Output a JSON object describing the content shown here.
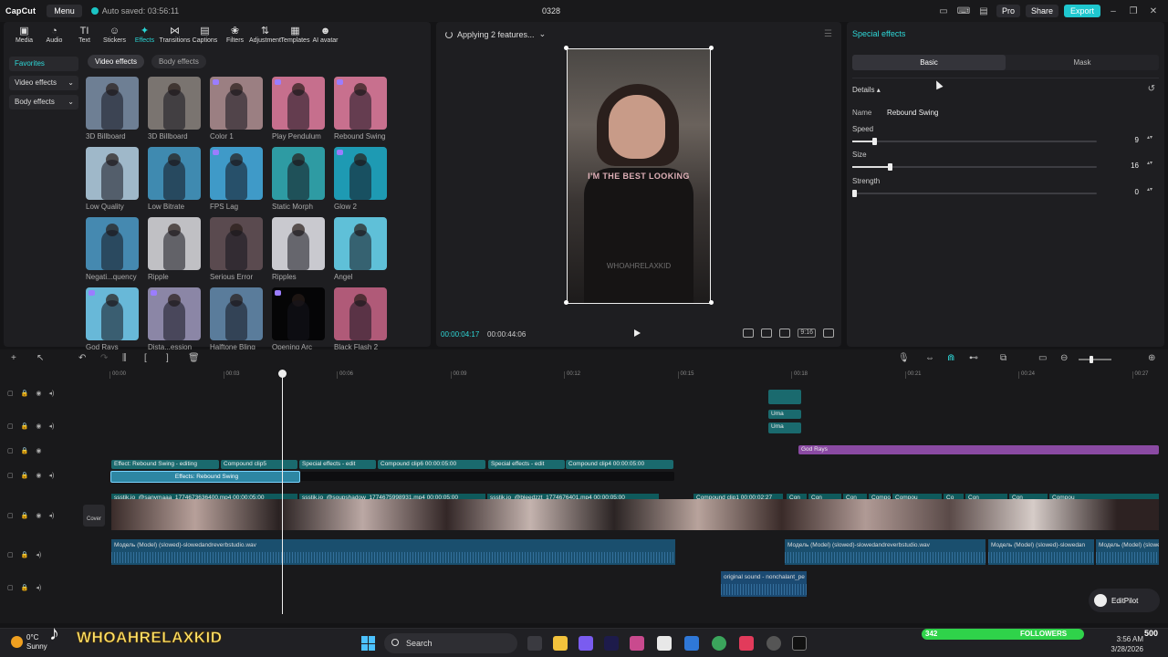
{
  "titlebar": {
    "app_name": "CapCut",
    "menu_label": "Menu",
    "autosave": "Auto saved: 03:56:11",
    "project_title": "0328",
    "pro_label": "Pro",
    "share_label": "Share",
    "export_label": "Export"
  },
  "toolbar": {
    "items": [
      {
        "label": "Media",
        "icon": "▣"
      },
      {
        "label": "Audio",
        "icon": "◔"
      },
      {
        "label": "Text",
        "icon": "TI"
      },
      {
        "label": "Stickers",
        "icon": "☺"
      },
      {
        "label": "Effects",
        "icon": "✦"
      },
      {
        "label": "Transitions",
        "icon": "⋈"
      },
      {
        "label": "Captions",
        "icon": "▤"
      },
      {
        "label": "Filters",
        "icon": "❀"
      },
      {
        "label": "Adjustment",
        "icon": "⇅"
      },
      {
        "label": "Templates",
        "icon": "▦"
      },
      {
        "label": "AI avatar",
        "icon": "☻"
      }
    ],
    "active": "Effects"
  },
  "effect_categories": [
    {
      "label": "Favorites"
    },
    {
      "label": "Video effects",
      "chevron": "⌄"
    },
    {
      "label": "Body effects",
      "chevron": "⌄"
    }
  ],
  "effect_subtabs": [
    {
      "label": "Video effects"
    },
    {
      "label": "Body effects"
    }
  ],
  "effects_grid": [
    {
      "label": "3D Billboard",
      "color": "#6e7f94"
    },
    {
      "label": "3D Billboard",
      "color": "#7a7470"
    },
    {
      "label": "Color 1",
      "color": "#9b7f82"
    },
    {
      "label": "Play Pendulum",
      "color": "#c66f8d"
    },
    {
      "label": "Rebound Swing",
      "color": "#c8708e"
    },
    {
      "label": "Low Quality",
      "color": "#9fb8c9"
    },
    {
      "label": "Low Bitrate",
      "color": "#3f8ab0"
    },
    {
      "label": "FPS Lag",
      "color": "#3f9ac8"
    },
    {
      "label": "Static Morph",
      "color": "#2e9ba3"
    },
    {
      "label": "Glow 2",
      "color": "#1e9ab3"
    },
    {
      "label": "Negati...quency",
      "color": "#4589b0"
    },
    {
      "label": "Ripple",
      "color": "#c0c0c4"
    },
    {
      "label": "Serious Error",
      "color": "#5a4a4f"
    },
    {
      "label": "Ripples",
      "color": "#c9c9cf"
    },
    {
      "label": "Angel",
      "color": "#5fc0d8"
    },
    {
      "label": "God Rays",
      "color": "#68b8d8"
    },
    {
      "label": "Dista...ession",
      "color": "#8b86a6"
    },
    {
      "label": "Halftone Bling",
      "color": "#5a7c9b"
    },
    {
      "label": "Opening Arc",
      "color": "#050506"
    },
    {
      "label": "Black Flash 2",
      "color": "#b05a78"
    }
  ],
  "preview": {
    "status": "Applying 2 features...",
    "caption": "I'M THE BEST LOOKING",
    "watermark": "WHOAHRELAXKID",
    "current_time": "00:00:04:17",
    "total_time": "00:00:44:06",
    "ratio_label": "9:16"
  },
  "special_effects": {
    "title": "Special effects",
    "tabs": [
      {
        "label": "Basic"
      },
      {
        "label": "Mask"
      }
    ],
    "active_tab": "Basic",
    "details_label": "Details",
    "name_label": "Name",
    "name_value": "Rebound Swing",
    "params": [
      {
        "label": "Speed",
        "value": "9",
        "fraction": 0.09
      },
      {
        "label": "Size",
        "value": "16",
        "fraction": 0.16
      },
      {
        "label": "Strength",
        "value": "0",
        "fraction": 0
      }
    ]
  },
  "timeline": {
    "ruler": [
      "00:00",
      "00:03",
      "00:06",
      "00:09",
      "00:12",
      "00:15",
      "00:18",
      "00:21",
      "00:24",
      "00:27"
    ],
    "small_clips": [
      "Uma",
      "Uma"
    ],
    "god_rays_clip": "God Rays",
    "effect_clips_top": [
      "Effect: Rebound Swing - editing",
      "Compound clip5",
      "Special effects - edit",
      "Compound clip6  00:00:05:00",
      "Special effects - edit",
      "Compound clip4  00:00:05:00"
    ],
    "selected_effect": "Effects:  Rebound Swing",
    "cover_label": "Cover",
    "video_headers": [
      "ssstik.io_@sanymaaa_1774673636400.mp4  00:00:05:00",
      "ssstik.io_@soupshadow_1774675998931.mp4  00:00:05:00",
      "ssstik.io_@bleedzzt_1774676401.mp4  00:00:05:00",
      "Compound clip1  00:00:02:27",
      "Con",
      "Con",
      "Con",
      "Compou",
      "Compou",
      "Co",
      "Con",
      "Con",
      "Compou"
    ],
    "audio_clips": [
      "Модель (Model) (slowed)-slowedandreverbstudio.wav",
      "Модель (Model) (slowed)-slowedandreverbstudio.wav",
      "Модель (Model) (slowed)-slowedan",
      "Модель (Model) (slowe"
    ],
    "original_sound": "original sound - nonchalant_pe"
  },
  "editpilot_label": "EditPilot",
  "taskbar": {
    "temperature": "0°C",
    "weather": "Sunny",
    "brand": "WHOAHRELAXKID",
    "search_placeholder": "Search",
    "followers_count": "342",
    "followers_label": "FOLLOWERS",
    "followers_goal": "500",
    "time": "3:56 AM",
    "date": "3/28/2026"
  }
}
